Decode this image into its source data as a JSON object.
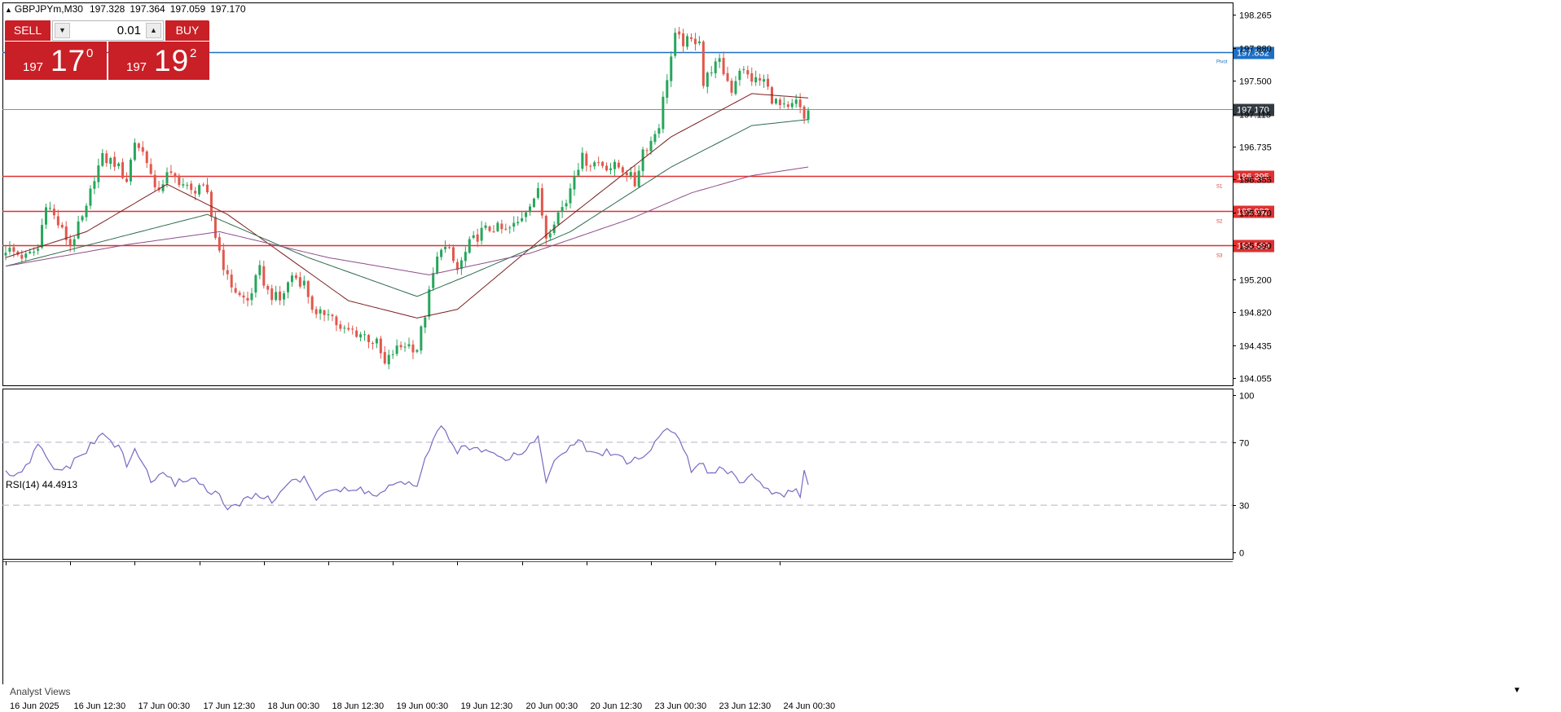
{
  "header": {
    "symbol": "GBPJPYm,M30",
    "open": "197.328",
    "high": "197.364",
    "low": "197.059",
    "close": "197.170"
  },
  "trade_panel": {
    "sell_label": "SELL",
    "buy_label": "BUY",
    "lot": "0.01",
    "sell_small": "197",
    "sell_big": "17",
    "sell_sup": "0",
    "buy_small": "197",
    "buy_big": "19",
    "buy_sup": "2"
  },
  "rsi_label": "RSI(14) 44.4913",
  "analyst_label": "Analyst Views",
  "colors": {
    "bull": "#26a65b",
    "bear": "#e2574c",
    "ma_fast": "#7a1f1f",
    "ma_mid": "#2e6b4e",
    "ma_slow": "#8e4e8a",
    "pivot": "#1e6fc4",
    "support": "#e03131",
    "rsi": "#7b68c4",
    "price_tag_dark": "#333b42"
  },
  "chart_data": [
    {
      "type": "candlestick",
      "symbol": "GBPJPYm",
      "timeframe": "M30",
      "ylim": [
        193.9,
        198.4
      ],
      "yticks": [
        "198.265",
        "197.880",
        "197.500",
        "197.115",
        "196.735",
        "196.355",
        "195.970",
        "195.590",
        "195.200",
        "194.820",
        "194.435",
        "194.055"
      ],
      "xticks": [
        "16 Jun 2025",
        "16 Jun 12:30",
        "17 Jun 00:30",
        "17 Jun 12:30",
        "18 Jun 00:30",
        "18 Jun 12:30",
        "19 Jun 00:30",
        "19 Jun 12:30",
        "20 Jun 00:30",
        "20 Jun 12:30",
        "23 Jun 00:30",
        "23 Jun 12:30",
        "24 Jun 00:30"
      ],
      "bars_count": 200,
      "close_path": [
        [
          0,
          195.55
        ],
        [
          5,
          195.45
        ],
        [
          8,
          195.55
        ],
        [
          10,
          196.1
        ],
        [
          14,
          195.75
        ],
        [
          16,
          195.6
        ],
        [
          20,
          196.0
        ],
        [
          22,
          196.4
        ],
        [
          24,
          196.6
        ],
        [
          27,
          196.55
        ],
        [
          30,
          196.35
        ],
        [
          32,
          196.8
        ],
        [
          35,
          196.6
        ],
        [
          37,
          196.2
        ],
        [
          40,
          196.4
        ],
        [
          43,
          196.35
        ],
        [
          46,
          196.2
        ],
        [
          48,
          196.3
        ],
        [
          50,
          196.15
        ],
        [
          52,
          195.7
        ],
        [
          55,
          195.2
        ],
        [
          58,
          195.0
        ],
        [
          60,
          194.95
        ],
        [
          63,
          195.3
        ],
        [
          65,
          195.05
        ],
        [
          68,
          194.95
        ],
        [
          71,
          195.25
        ],
        [
          74,
          195.15
        ],
        [
          77,
          194.75
        ],
        [
          80,
          194.85
        ],
        [
          83,
          194.6
        ],
        [
          86,
          194.6
        ],
        [
          89,
          194.55
        ],
        [
          92,
          194.45
        ],
        [
          94,
          194.2
        ],
        [
          96,
          194.35
        ],
        [
          99,
          194.45
        ],
        [
          102,
          194.4
        ],
        [
          104,
          194.8
        ],
        [
          106,
          195.25
        ],
        [
          108,
          195.6
        ],
        [
          110,
          195.5
        ],
        [
          112,
          195.3
        ],
        [
          115,
          195.6
        ],
        [
          118,
          195.75
        ],
        [
          121,
          195.8
        ],
        [
          124,
          195.75
        ],
        [
          127,
          195.85
        ],
        [
          130,
          196.1
        ],
        [
          132,
          196.2
        ],
        [
          134,
          195.7
        ],
        [
          136,
          195.9
        ],
        [
          139,
          196.1
        ],
        [
          141,
          196.45
        ],
        [
          143,
          196.6
        ],
        [
          145,
          196.55
        ],
        [
          147,
          196.55
        ],
        [
          150,
          196.5
        ],
        [
          152,
          196.5
        ],
        [
          154,
          196.45
        ],
        [
          156,
          196.3
        ],
        [
          158,
          196.7
        ],
        [
          160,
          196.8
        ],
        [
          162,
          197.0
        ],
        [
          164,
          197.55
        ],
        [
          166,
          198.0
        ],
        [
          168,
          197.95
        ],
        [
          170,
          197.95
        ],
        [
          172,
          198.0
        ],
        [
          173,
          197.45
        ],
        [
          175,
          197.65
        ],
        [
          177,
          197.7
        ],
        [
          180,
          197.4
        ],
        [
          182,
          197.65
        ],
        [
          184,
          197.55
        ],
        [
          186,
          197.5
        ],
        [
          188,
          197.5
        ],
        [
          190,
          197.3
        ],
        [
          192,
          197.2
        ],
        [
          194,
          197.15
        ],
        [
          196,
          197.25
        ],
        [
          198,
          197.05
        ],
        [
          199,
          197.17
        ]
      ],
      "moving_averages": [
        {
          "key": "ma_fast",
          "approx_path": [
            [
              0,
              195.45
            ],
            [
              20,
              195.75
            ],
            [
              40,
              196.3
            ],
            [
              55,
              195.95
            ],
            [
              85,
              194.95
            ],
            [
              102,
              194.75
            ],
            [
              112,
              194.85
            ],
            [
              135,
              195.75
            ],
            [
              165,
              196.85
            ],
            [
              185,
              197.35
            ],
            [
              199,
              197.3
            ]
          ]
        },
        {
          "key": "ma_mid",
          "approx_path": [
            [
              0,
              195.35
            ],
            [
              25,
              195.65
            ],
            [
              50,
              195.95
            ],
            [
              75,
              195.45
            ],
            [
              102,
              195.0
            ],
            [
              115,
              195.25
            ],
            [
              140,
              195.75
            ],
            [
              165,
              196.5
            ],
            [
              185,
              196.98
            ],
            [
              199,
              197.05
            ]
          ]
        },
        {
          "key": "ma_slow",
          "approx_path": [
            [
              0,
              195.35
            ],
            [
              30,
              195.6
            ],
            [
              53,
              195.75
            ],
            [
              80,
              195.45
            ],
            [
              105,
              195.25
            ],
            [
              130,
              195.5
            ],
            [
              155,
              195.9
            ],
            [
              170,
              196.2
            ],
            [
              185,
              196.4
            ],
            [
              199,
              196.5
            ]
          ]
        }
      ],
      "levels": [
        {
          "name": "Pivot",
          "value": 197.832,
          "label": "197.832",
          "key": "pivot"
        },
        {
          "name": "S1",
          "value": 196.395,
          "label": "196.395",
          "key": "support"
        },
        {
          "name": "S2",
          "value": 195.992,
          "label": "195.992",
          "key": "support"
        },
        {
          "name": "S3",
          "value": 195.589,
          "label": "195.589",
          "key": "support"
        }
      ],
      "current_price": {
        "value": 197.17,
        "label": "197.170"
      }
    },
    {
      "type": "line",
      "title": "RSI(14)",
      "last_value": 44.4913,
      "ylim": [
        0,
        100
      ],
      "yticks": [
        "100",
        "70",
        "30",
        "0"
      ],
      "levels": [
        70,
        30
      ],
      "approx_path": [
        [
          0,
          50
        ],
        [
          4,
          49
        ],
        [
          8,
          68
        ],
        [
          12,
          52
        ],
        [
          16,
          55
        ],
        [
          20,
          65
        ],
        [
          24,
          75
        ],
        [
          28,
          67
        ],
        [
          30,
          55
        ],
        [
          32,
          65
        ],
        [
          34,
          57
        ],
        [
          36,
          45
        ],
        [
          38,
          50
        ],
        [
          42,
          44
        ],
        [
          46,
          48
        ],
        [
          50,
          40
        ],
        [
          52,
          38
        ],
        [
          55,
          28
        ],
        [
          58,
          30
        ],
        [
          62,
          38
        ],
        [
          66,
          32
        ],
        [
          70,
          45
        ],
        [
          74,
          46
        ],
        [
          77,
          35
        ],
        [
          80,
          40
        ],
        [
          84,
          39
        ],
        [
          88,
          40
        ],
        [
          92,
          36
        ],
        [
          96,
          43
        ],
        [
          100,
          43
        ],
        [
          102,
          40
        ],
        [
          104,
          62
        ],
        [
          106,
          70
        ],
        [
          108,
          80
        ],
        [
          110,
          70
        ],
        [
          112,
          65
        ],
        [
          116,
          66
        ],
        [
          120,
          66
        ],
        [
          124,
          60
        ],
        [
          128,
          64
        ],
        [
          132,
          73
        ],
        [
          134,
          47
        ],
        [
          136,
          56
        ],
        [
          140,
          68
        ],
        [
          142,
          70
        ],
        [
          146,
          62
        ],
        [
          150,
          64
        ],
        [
          154,
          58
        ],
        [
          158,
          60
        ],
        [
          160,
          65
        ],
        [
          162,
          75
        ],
        [
          164,
          78
        ],
        [
          166,
          76
        ],
        [
          168,
          68
        ],
        [
          170,
          50
        ],
        [
          172,
          56
        ],
        [
          174,
          52
        ],
        [
          178,
          54
        ],
        [
          182,
          46
        ],
        [
          186,
          49
        ],
        [
          190,
          36
        ],
        [
          194,
          38
        ],
        [
          196,
          40
        ],
        [
          197,
          35
        ],
        [
          198,
          52
        ],
        [
          199,
          44.49
        ]
      ]
    }
  ]
}
